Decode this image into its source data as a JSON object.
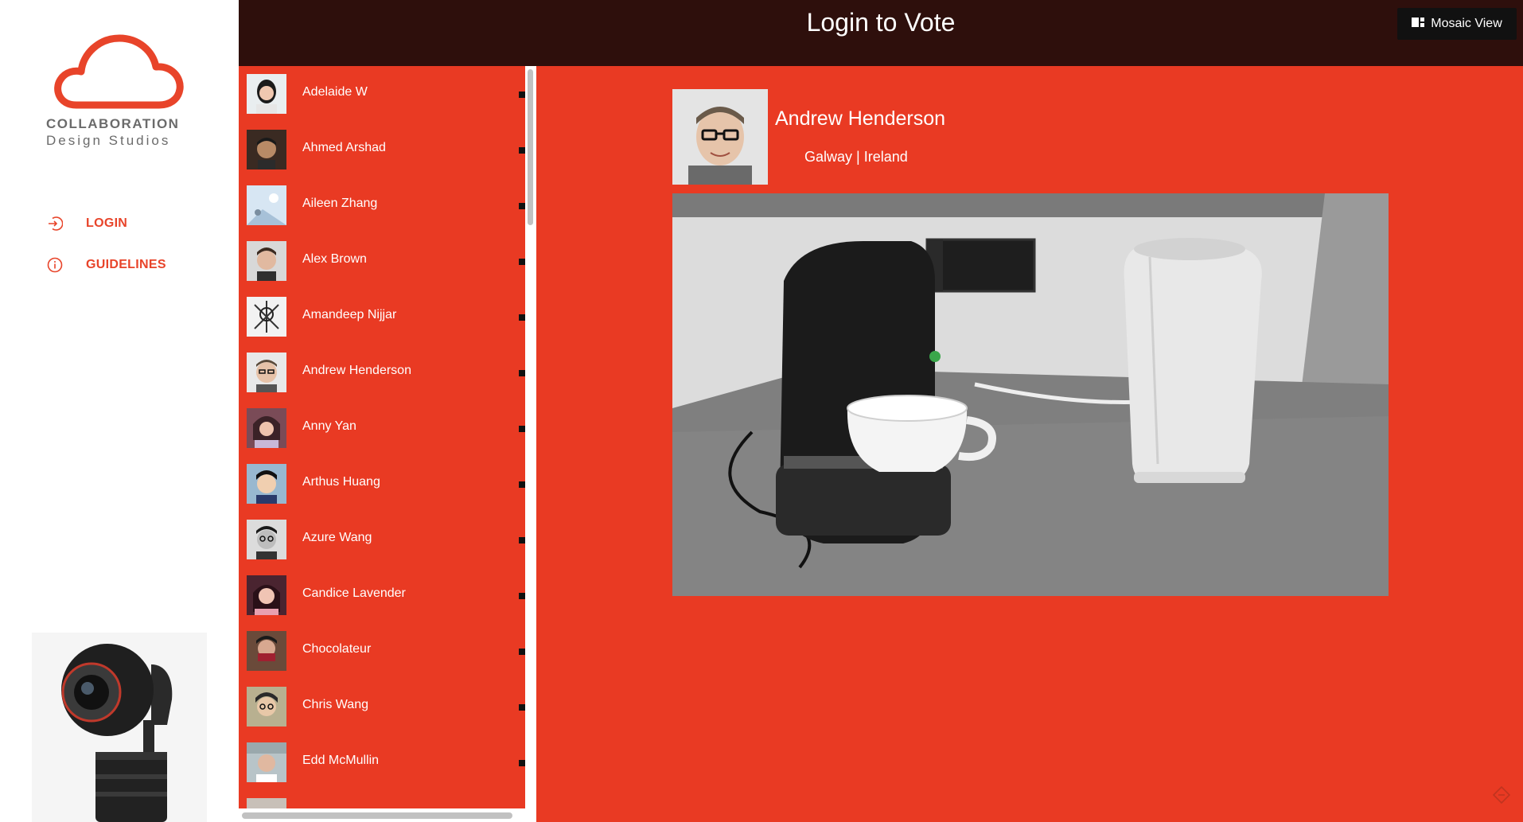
{
  "brand": {
    "line1": "COLLABORATION",
    "line2": "Design Studios",
    "icon": "cloud-icon",
    "color": "#e8442a"
  },
  "nav": {
    "items": [
      {
        "label": "LOGIN",
        "icon": "login-icon"
      },
      {
        "label": "GUIDELINES",
        "icon": "info-icon"
      }
    ]
  },
  "header": {
    "title": "Login to Vote",
    "mosaic_button": "Mosaic View",
    "mosaic_icon": "grid-icon"
  },
  "users": [
    {
      "name": "Adelaide W"
    },
    {
      "name": "Ahmed Arshad"
    },
    {
      "name": "Aileen Zhang"
    },
    {
      "name": "Alex Brown"
    },
    {
      "name": "Amandeep Nijjar"
    },
    {
      "name": "Andrew Henderson"
    },
    {
      "name": "Anny Yan"
    },
    {
      "name": "Arthus Huang"
    },
    {
      "name": "Azure Wang"
    },
    {
      "name": "Candice Lavender"
    },
    {
      "name": "Chocolateur"
    },
    {
      "name": "Chris Wang"
    },
    {
      "name": "Edd McMullin"
    },
    {
      "name": ""
    }
  ],
  "profile": {
    "name": "Andrew Henderson",
    "location": "Galway | Ireland"
  },
  "colors": {
    "accent": "#e93a23",
    "header_bg": "#2e0f0c",
    "button_bg": "#111111"
  }
}
